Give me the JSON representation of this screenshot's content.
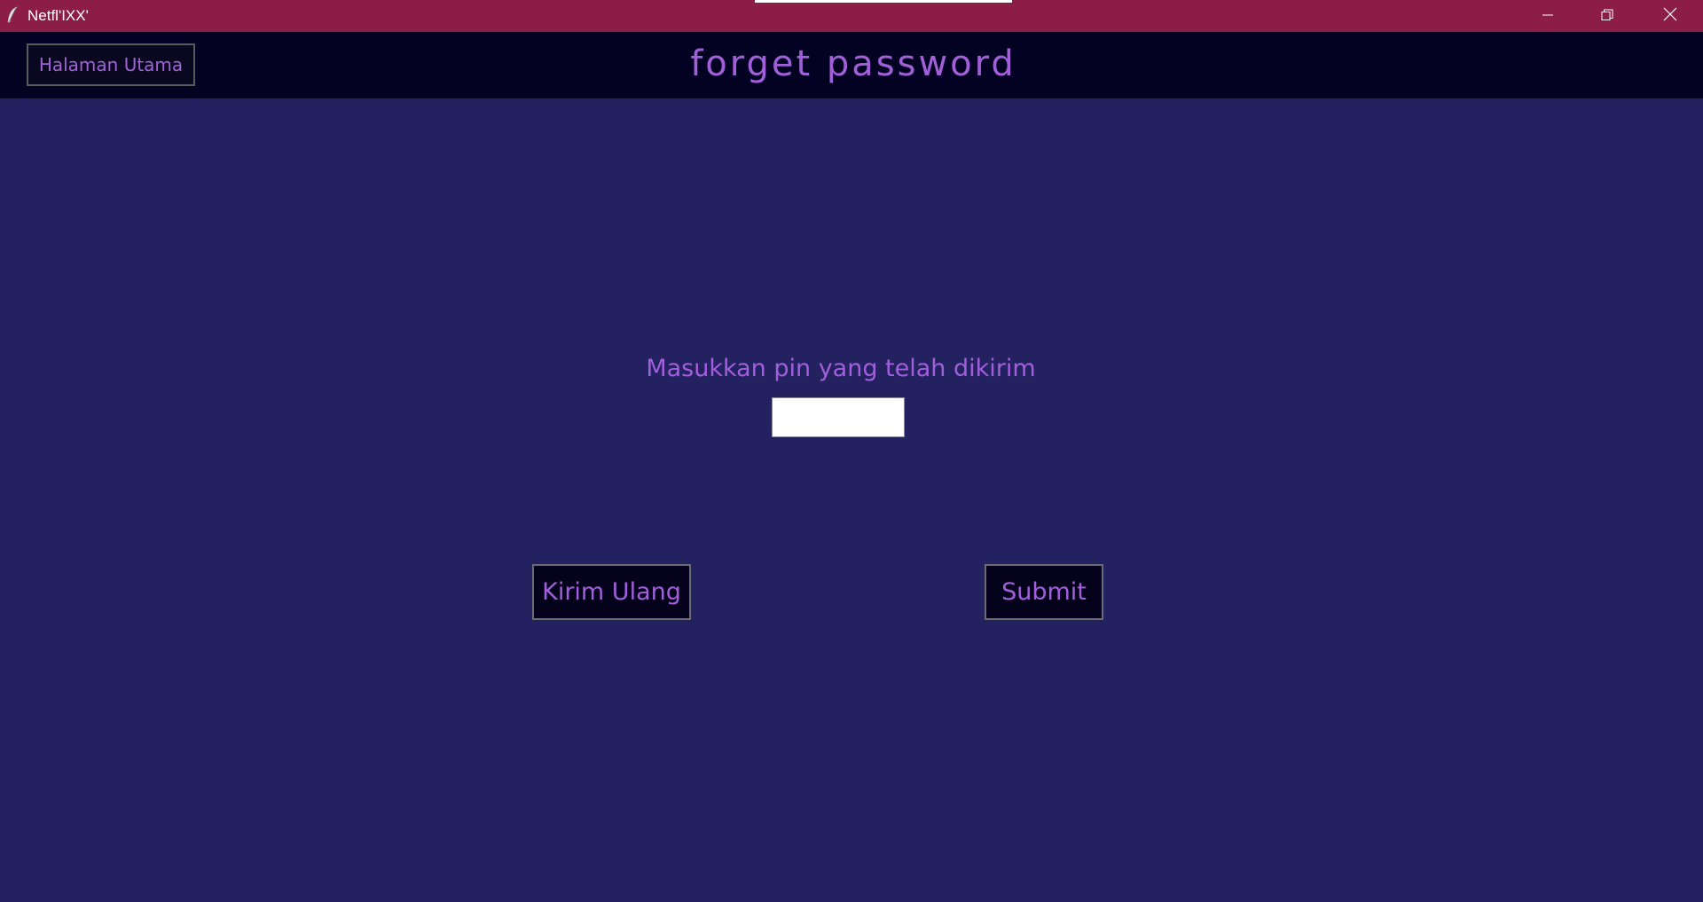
{
  "window": {
    "title": "Netfl'IXX'",
    "icon": "feather-icon",
    "controls": [
      "minimize-icon",
      "restore-icon",
      "close-icon"
    ],
    "colors": {
      "titlebar": "#8c1d45"
    }
  },
  "header": {
    "home_button_label": "Halaman Utama",
    "page_title": "forget password",
    "colors": {
      "background": "#040222",
      "accent": "#a160d8"
    }
  },
  "main": {
    "pin_label": "Masukkan pin yang telah dikirim",
    "pin_input": {
      "value": "",
      "placeholder": ""
    },
    "resend_button_label": "Kirim Ulang",
    "submit_button_label": "Submit",
    "colors": {
      "background": "#242160",
      "text": "#a25fdc"
    }
  }
}
